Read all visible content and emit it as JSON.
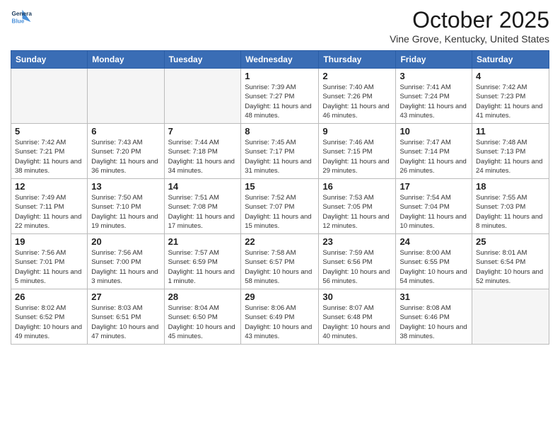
{
  "logo": {
    "line1": "General",
    "line2": "Blue"
  },
  "title": "October 2025",
  "subtitle": "Vine Grove, Kentucky, United States",
  "weekdays": [
    "Sunday",
    "Monday",
    "Tuesday",
    "Wednesday",
    "Thursday",
    "Friday",
    "Saturday"
  ],
  "weeks": [
    [
      {
        "day": "",
        "info": ""
      },
      {
        "day": "",
        "info": ""
      },
      {
        "day": "",
        "info": ""
      },
      {
        "day": "1",
        "info": "Sunrise: 7:39 AM\nSunset: 7:27 PM\nDaylight: 11 hours and 48 minutes."
      },
      {
        "day": "2",
        "info": "Sunrise: 7:40 AM\nSunset: 7:26 PM\nDaylight: 11 hours and 46 minutes."
      },
      {
        "day": "3",
        "info": "Sunrise: 7:41 AM\nSunset: 7:24 PM\nDaylight: 11 hours and 43 minutes."
      },
      {
        "day": "4",
        "info": "Sunrise: 7:42 AM\nSunset: 7:23 PM\nDaylight: 11 hours and 41 minutes."
      }
    ],
    [
      {
        "day": "5",
        "info": "Sunrise: 7:42 AM\nSunset: 7:21 PM\nDaylight: 11 hours and 38 minutes."
      },
      {
        "day": "6",
        "info": "Sunrise: 7:43 AM\nSunset: 7:20 PM\nDaylight: 11 hours and 36 minutes."
      },
      {
        "day": "7",
        "info": "Sunrise: 7:44 AM\nSunset: 7:18 PM\nDaylight: 11 hours and 34 minutes."
      },
      {
        "day": "8",
        "info": "Sunrise: 7:45 AM\nSunset: 7:17 PM\nDaylight: 11 hours and 31 minutes."
      },
      {
        "day": "9",
        "info": "Sunrise: 7:46 AM\nSunset: 7:15 PM\nDaylight: 11 hours and 29 minutes."
      },
      {
        "day": "10",
        "info": "Sunrise: 7:47 AM\nSunset: 7:14 PM\nDaylight: 11 hours and 26 minutes."
      },
      {
        "day": "11",
        "info": "Sunrise: 7:48 AM\nSunset: 7:13 PM\nDaylight: 11 hours and 24 minutes."
      }
    ],
    [
      {
        "day": "12",
        "info": "Sunrise: 7:49 AM\nSunset: 7:11 PM\nDaylight: 11 hours and 22 minutes."
      },
      {
        "day": "13",
        "info": "Sunrise: 7:50 AM\nSunset: 7:10 PM\nDaylight: 11 hours and 19 minutes."
      },
      {
        "day": "14",
        "info": "Sunrise: 7:51 AM\nSunset: 7:08 PM\nDaylight: 11 hours and 17 minutes."
      },
      {
        "day": "15",
        "info": "Sunrise: 7:52 AM\nSunset: 7:07 PM\nDaylight: 11 hours and 15 minutes."
      },
      {
        "day": "16",
        "info": "Sunrise: 7:53 AM\nSunset: 7:05 PM\nDaylight: 11 hours and 12 minutes."
      },
      {
        "day": "17",
        "info": "Sunrise: 7:54 AM\nSunset: 7:04 PM\nDaylight: 11 hours and 10 minutes."
      },
      {
        "day": "18",
        "info": "Sunrise: 7:55 AM\nSunset: 7:03 PM\nDaylight: 11 hours and 8 minutes."
      }
    ],
    [
      {
        "day": "19",
        "info": "Sunrise: 7:56 AM\nSunset: 7:01 PM\nDaylight: 11 hours and 5 minutes."
      },
      {
        "day": "20",
        "info": "Sunrise: 7:56 AM\nSunset: 7:00 PM\nDaylight: 11 hours and 3 minutes."
      },
      {
        "day": "21",
        "info": "Sunrise: 7:57 AM\nSunset: 6:59 PM\nDaylight: 11 hours and 1 minute."
      },
      {
        "day": "22",
        "info": "Sunrise: 7:58 AM\nSunset: 6:57 PM\nDaylight: 10 hours and 58 minutes."
      },
      {
        "day": "23",
        "info": "Sunrise: 7:59 AM\nSunset: 6:56 PM\nDaylight: 10 hours and 56 minutes."
      },
      {
        "day": "24",
        "info": "Sunrise: 8:00 AM\nSunset: 6:55 PM\nDaylight: 10 hours and 54 minutes."
      },
      {
        "day": "25",
        "info": "Sunrise: 8:01 AM\nSunset: 6:54 PM\nDaylight: 10 hours and 52 minutes."
      }
    ],
    [
      {
        "day": "26",
        "info": "Sunrise: 8:02 AM\nSunset: 6:52 PM\nDaylight: 10 hours and 49 minutes."
      },
      {
        "day": "27",
        "info": "Sunrise: 8:03 AM\nSunset: 6:51 PM\nDaylight: 10 hours and 47 minutes."
      },
      {
        "day": "28",
        "info": "Sunrise: 8:04 AM\nSunset: 6:50 PM\nDaylight: 10 hours and 45 minutes."
      },
      {
        "day": "29",
        "info": "Sunrise: 8:06 AM\nSunset: 6:49 PM\nDaylight: 10 hours and 43 minutes."
      },
      {
        "day": "30",
        "info": "Sunrise: 8:07 AM\nSunset: 6:48 PM\nDaylight: 10 hours and 40 minutes."
      },
      {
        "day": "31",
        "info": "Sunrise: 8:08 AM\nSunset: 6:46 PM\nDaylight: 10 hours and 38 minutes."
      },
      {
        "day": "",
        "info": ""
      }
    ]
  ]
}
